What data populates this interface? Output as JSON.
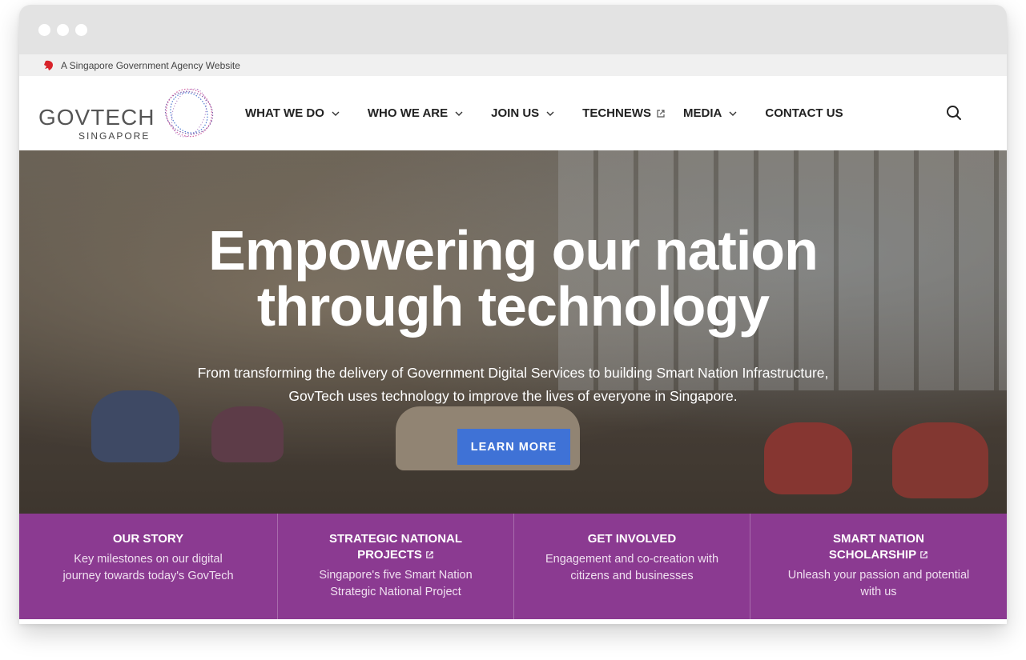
{
  "masthead": {
    "text": "A Singapore Government Agency Website"
  },
  "logo": {
    "main": "GOVTECH",
    "sub": "SINGAPORE"
  },
  "nav": {
    "items": [
      {
        "label": "WHAT WE DO",
        "icon": "chevron-down-icon"
      },
      {
        "label": "WHO WE ARE",
        "icon": "chevron-down-icon"
      },
      {
        "label": "JOIN US",
        "icon": "chevron-down-icon"
      },
      {
        "label": "TECHNEWS",
        "icon": "external-link-icon"
      },
      {
        "label": "MEDIA",
        "icon": "chevron-down-icon"
      },
      {
        "label": "CONTACT US"
      }
    ],
    "search_icon": "search-icon"
  },
  "hero": {
    "title_line1": "Empowering our nation",
    "title_line2": "through technology",
    "subtitle_line1": "From transforming the delivery of Government Digital Services to building Smart Nation Infrastructure,",
    "subtitle_line2": "GovTech uses technology to improve the lives of everyone in Singapore.",
    "cta_label": "LEARN MORE"
  },
  "cards": [
    {
      "title_line1": "OUR STORY",
      "title_line2": "",
      "desc_line1": "Key milestones on our digital",
      "desc_line2": "journey towards today's GovTech"
    },
    {
      "title_line1": "STRATEGIC NATIONAL",
      "title_line2": "PROJECTS",
      "desc_line1": "Singapore's five Smart Nation",
      "desc_line2": "Strategic National Project"
    },
    {
      "title_line1": "GET INVOLVED",
      "title_line2": "",
      "desc_line1": "Engagement and co-creation with",
      "desc_line2": "citizens and businesses"
    },
    {
      "title_line1": "SMART NATION",
      "title_line2": "SCHOLARSHIP",
      "desc_line1": "Unleash your passion and potential",
      "desc_line2": "with us"
    }
  ],
  "colors": {
    "accent_purple": "#8b3a91",
    "cta_blue": "#3f72d6",
    "lion_red": "#d8232a"
  }
}
